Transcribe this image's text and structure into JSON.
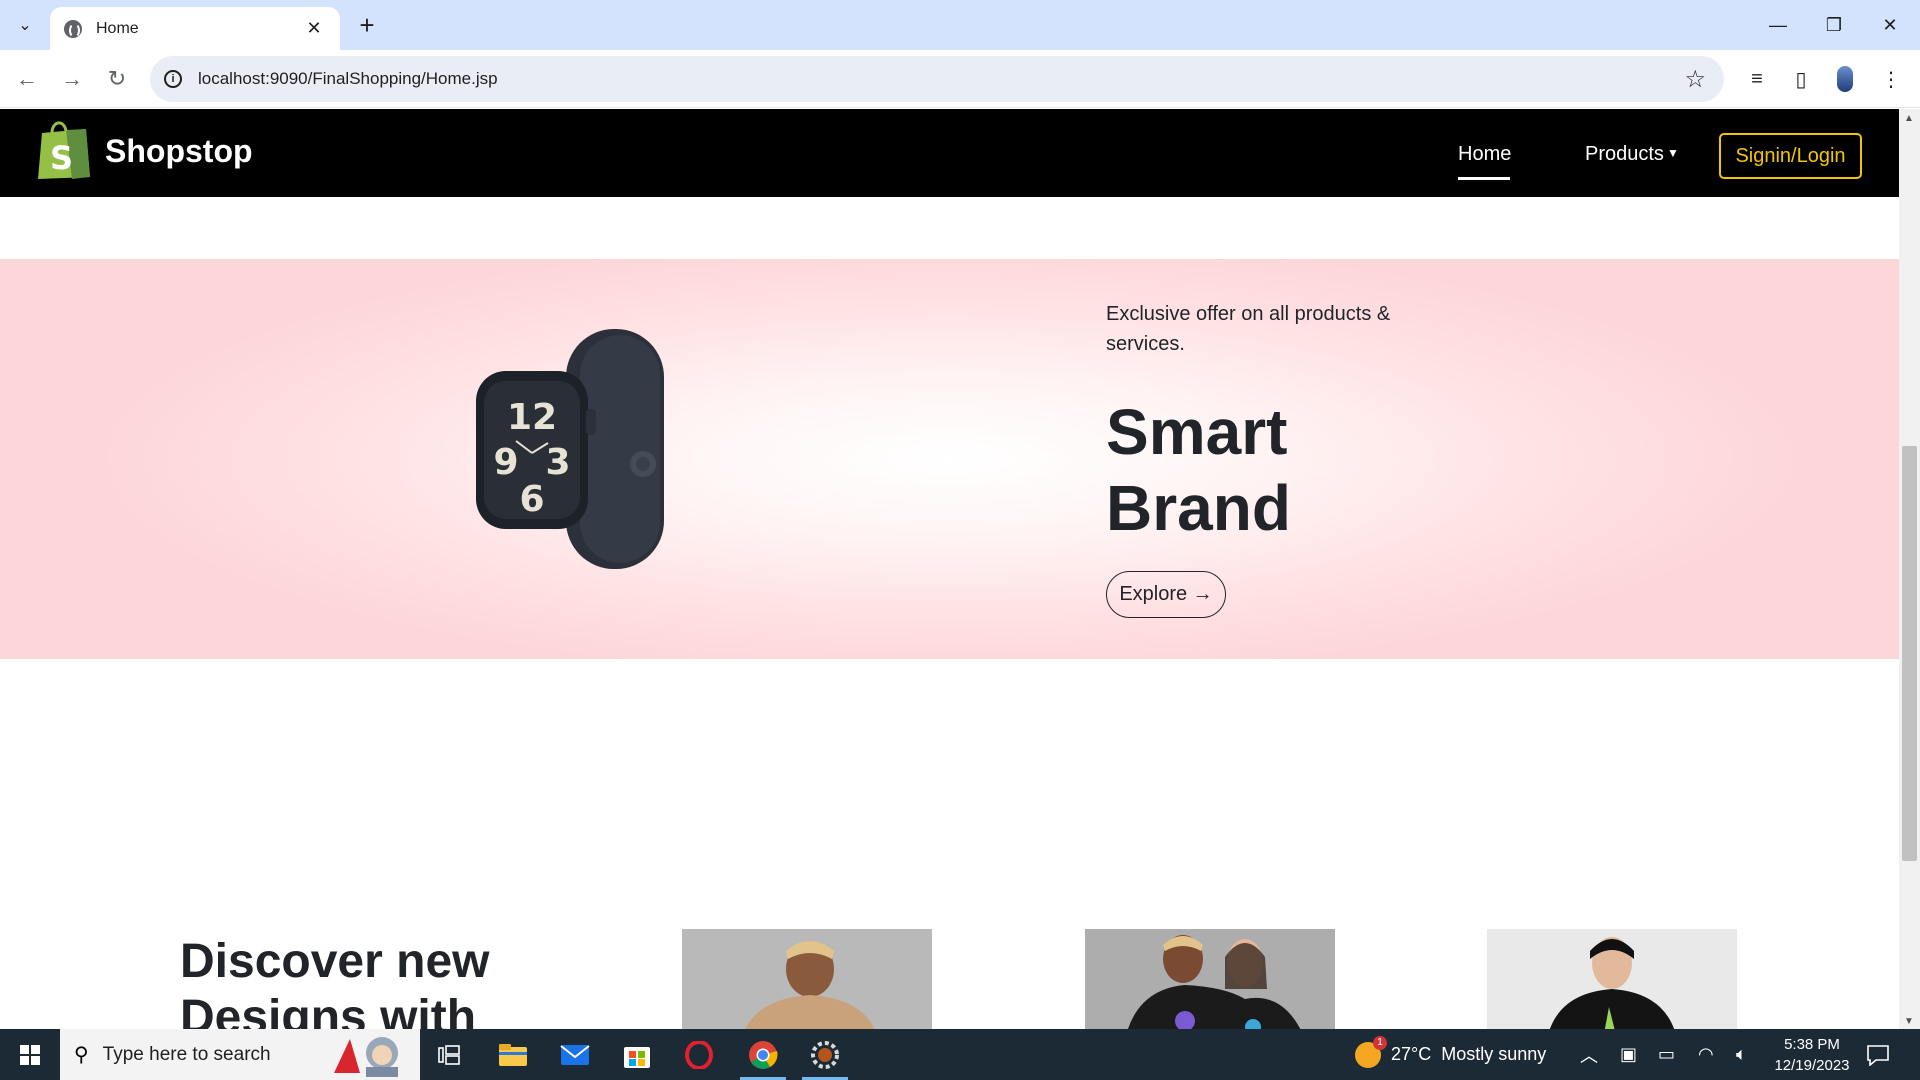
{
  "browser": {
    "tab_title": "Home",
    "url": "localhost:9090/FinalShopping/Home.jsp"
  },
  "site": {
    "brand": "Shopstop",
    "nav": {
      "home": "Home",
      "products": "Products",
      "signin": "Signin/Login"
    },
    "hero": {
      "offer": "Exclusive offer on all products & services.",
      "title_line1": "Smart",
      "title_line2": "Brand",
      "explore": "Explore →"
    },
    "discover": {
      "line1": "Discover new",
      "line2": "Designs with"
    }
  },
  "taskbar": {
    "search_placeholder": "Type here to search",
    "weather_temp": "27°C",
    "weather_text": "Mostly sunny",
    "weather_badge": "1",
    "time": "5:38 PM",
    "date": "12/19/2023"
  },
  "colors": {
    "navbar": "#000000",
    "signin_accent": "#f2c500",
    "hero_bg": "#fdd6d9",
    "taskbar": "#1c2a35"
  }
}
